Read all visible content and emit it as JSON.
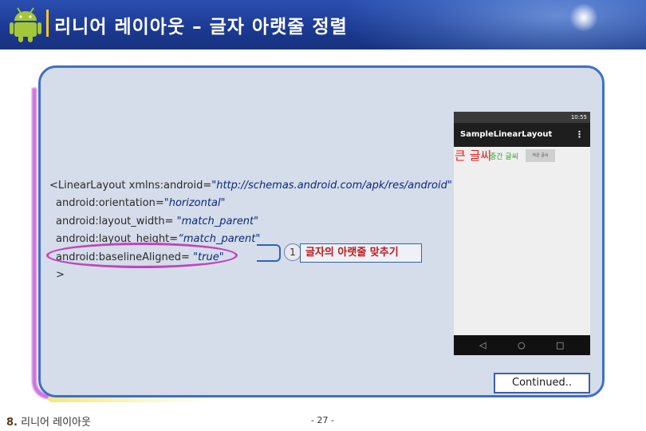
{
  "header": {
    "title": "리니어 레이아웃 – 글자 아랫줄 정렬"
  },
  "code": {
    "line1_prefix": "<LinearLayout xmlns:android=",
    "line1_value": "\"http://schemas.android.com/apk/res/android\"",
    "line2_prefix": "android:orientation=",
    "line2_value": "\"horizontal\"",
    "line3_prefix": "android:layout_width=",
    "line3_value": "\"match_parent\"",
    "line4_prefix": "android:layout_height=",
    "line4_value": "“match_parent\"",
    "line5_prefix": "android:baselineAligned=",
    "line5_value": "\"true\"",
    "line6": ">"
  },
  "callout": {
    "number": "1",
    "text": "글자의 아랫줄 맞추기"
  },
  "phone": {
    "time": "10:55",
    "app_title": "SampleLinearLayout",
    "menu_icon": "overflow-menu-icon",
    "text_big": "큰 글씨",
    "text_mid": "중간 글씨",
    "text_small": "작은 글씨",
    "nav": [
      "◁",
      "○",
      "□"
    ]
  },
  "footer": {
    "continued": "Continued..",
    "section_number": "8.",
    "section_title": "리니어 레이아웃",
    "page": "- 27 -"
  },
  "colors": {
    "header_bg": "#1c3a93",
    "panel_border": "#3f6fc4",
    "oval": "#c046b8",
    "callout_text": "#c01818"
  }
}
